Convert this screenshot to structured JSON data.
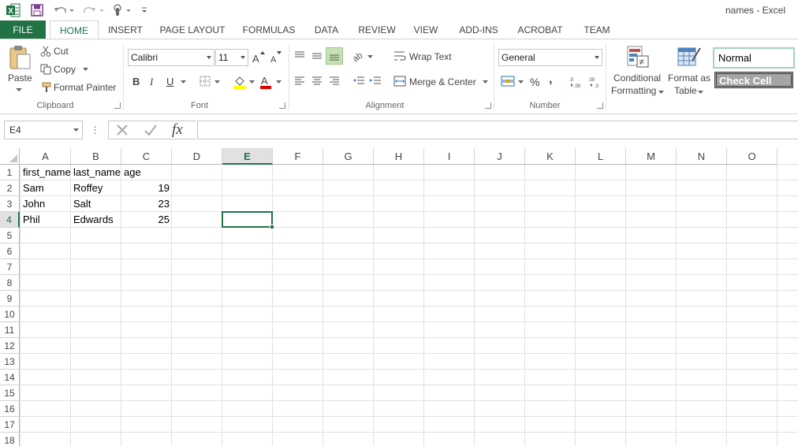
{
  "title_bar": {
    "window_title": "names - Excel"
  },
  "tabs": [
    "FILE",
    "HOME",
    "INSERT",
    "PAGE LAYOUT",
    "FORMULAS",
    "DATA",
    "REVIEW",
    "VIEW",
    "ADD-INS",
    "ACROBAT",
    "TEAM"
  ],
  "ribbon": {
    "clipboard": {
      "paste": "Paste",
      "cut": "Cut",
      "copy": "Copy",
      "format_painter": "Format Painter",
      "label": "Clipboard"
    },
    "font": {
      "font_name": "Calibri",
      "font_size": "11",
      "bold": "B",
      "italic": "I",
      "underline": "U",
      "label": "Font"
    },
    "alignment": {
      "wrap_text": "Wrap Text",
      "merge_center": "Merge & Center",
      "label": "Alignment"
    },
    "number": {
      "format": "General",
      "percent": "%",
      "comma": ",",
      "label": "Number"
    },
    "styles": {
      "conditional_formatting": [
        "Conditional",
        "Formatting"
      ],
      "format_as_table": [
        "Format as",
        "Table"
      ],
      "normal": "Normal",
      "check_cell": "Check Cell"
    }
  },
  "formula_bar": {
    "name_box": "E4",
    "fx": "fx",
    "formula": ""
  },
  "sheet": {
    "columns": [
      "A",
      "B",
      "C",
      "D",
      "E",
      "F",
      "G",
      "H",
      "I",
      "J",
      "K",
      "L",
      "M",
      "N",
      "O"
    ],
    "rows": [
      "1",
      "2",
      "3",
      "4",
      "5",
      "6",
      "7",
      "8",
      "9",
      "10",
      "11",
      "12",
      "13",
      "14",
      "15",
      "16",
      "17",
      "18"
    ],
    "selected_cell": "E4",
    "cells": [
      [
        "first_name",
        "last_name",
        "age"
      ],
      [
        "Sam",
        "Roffey",
        "19"
      ],
      [
        "John",
        "Salt",
        "23"
      ],
      [
        "Phil",
        "Edwards",
        "25"
      ]
    ]
  },
  "colors": {
    "accent": "#217346"
  }
}
